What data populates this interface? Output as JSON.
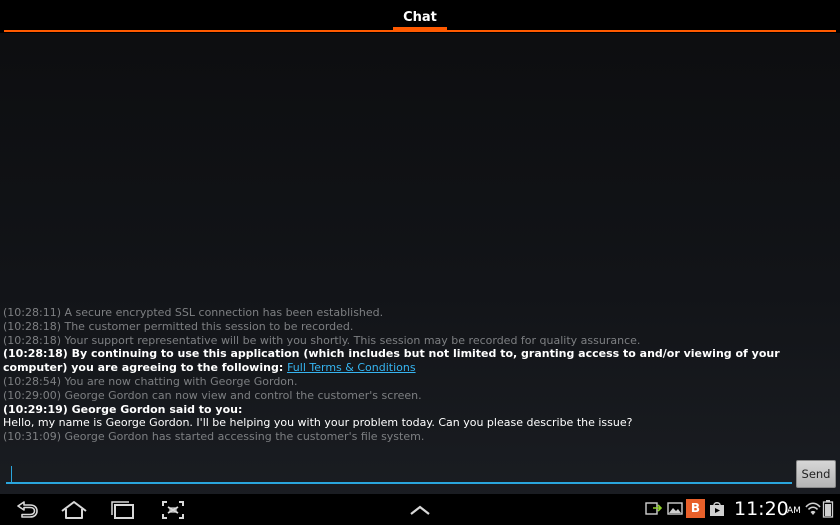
{
  "header": {
    "tabs": [
      {
        "label": "Chat",
        "active": true
      }
    ],
    "accent_color": "#ff5a00"
  },
  "chat": {
    "messages": [
      {
        "style": "system",
        "text": "(10:28:11) A secure encrypted SSL connection has been established."
      },
      {
        "style": "system",
        "text": "(10:28:18) The customer permitted this session to be recorded."
      },
      {
        "style": "system",
        "text": "(10:28:18) Your support representative will be with you shortly. This session may be recorded for quality assurance."
      },
      {
        "style": "bold",
        "text": "(10:28:18) By continuing to use this application (which includes but not limited to, granting access to and/or viewing of your computer) you are agreeing to the following: ",
        "link": "Full Terms & Conditions"
      },
      {
        "style": "system",
        "text": "(10:28:54) You are now chatting with George Gordon."
      },
      {
        "style": "system",
        "text": "(10:29:00) George Gordon can now view and control the customer's screen."
      },
      {
        "style": "bold",
        "text": "(10:29:19) George Gordon said to you:"
      },
      {
        "style": "plain",
        "text": "Hello, my name is George Gordon. I'll be helping you with your problem today. Can you please describe the issue?"
      },
      {
        "style": "system",
        "text": "(10:31:09) George Gordon has started accessing the customer's file system."
      }
    ],
    "link_color": "#36b4f0"
  },
  "composer": {
    "input_value": "",
    "send_label": "Send",
    "focus_color": "#2aa5dc"
  },
  "navbar": {
    "buttons": [
      "back-icon",
      "home-icon",
      "recent-apps-icon",
      "screenshot-icon",
      "chevron-up-icon"
    ],
    "status_icons": [
      "screen-share-icon",
      "image-icon",
      "b-app-icon",
      "store-bag-icon",
      "wifi-icon",
      "battery-icon"
    ],
    "b_badge": "B",
    "time": "11:20",
    "ampm": "AM"
  }
}
